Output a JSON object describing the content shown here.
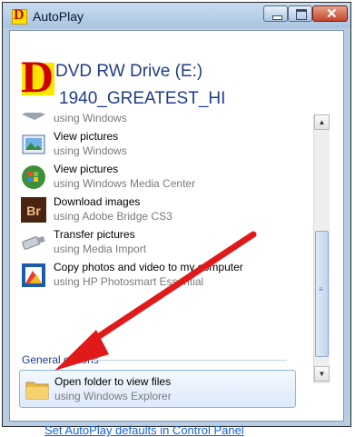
{
  "window": {
    "title": "AutoPlay"
  },
  "drive": {
    "name": "DVD RW Drive (E:)",
    "media": "1940_GREATEST_HI"
  },
  "options": [
    {
      "action": "",
      "via": "using Windows",
      "icon": "partial-icon"
    },
    {
      "action": "View pictures",
      "via": "using Windows",
      "icon": "photo-viewer-icon"
    },
    {
      "action": "View pictures",
      "via": "using Windows Media Center",
      "icon": "media-center-icon"
    },
    {
      "action": "Download images",
      "via": "using Adobe Bridge CS3",
      "icon": "adobe-bridge-icon"
    },
    {
      "action": "Transfer pictures",
      "via": "using Media Import",
      "icon": "usb-camera-icon"
    },
    {
      "action": "Copy photos and video to my computer",
      "via": "using HP Photosmart Essential",
      "icon": "photosmart-icon"
    }
  ],
  "general": {
    "header": "General options",
    "item": {
      "action": "Open folder to view files",
      "via": "using Windows Explorer",
      "icon": "folder-icon"
    }
  },
  "footer": {
    "link": "Set AutoPlay defaults in Control Panel"
  },
  "colors": {
    "link": "#1560d4",
    "heading": "#1f3d8a",
    "arrow": "#e01a1a"
  }
}
